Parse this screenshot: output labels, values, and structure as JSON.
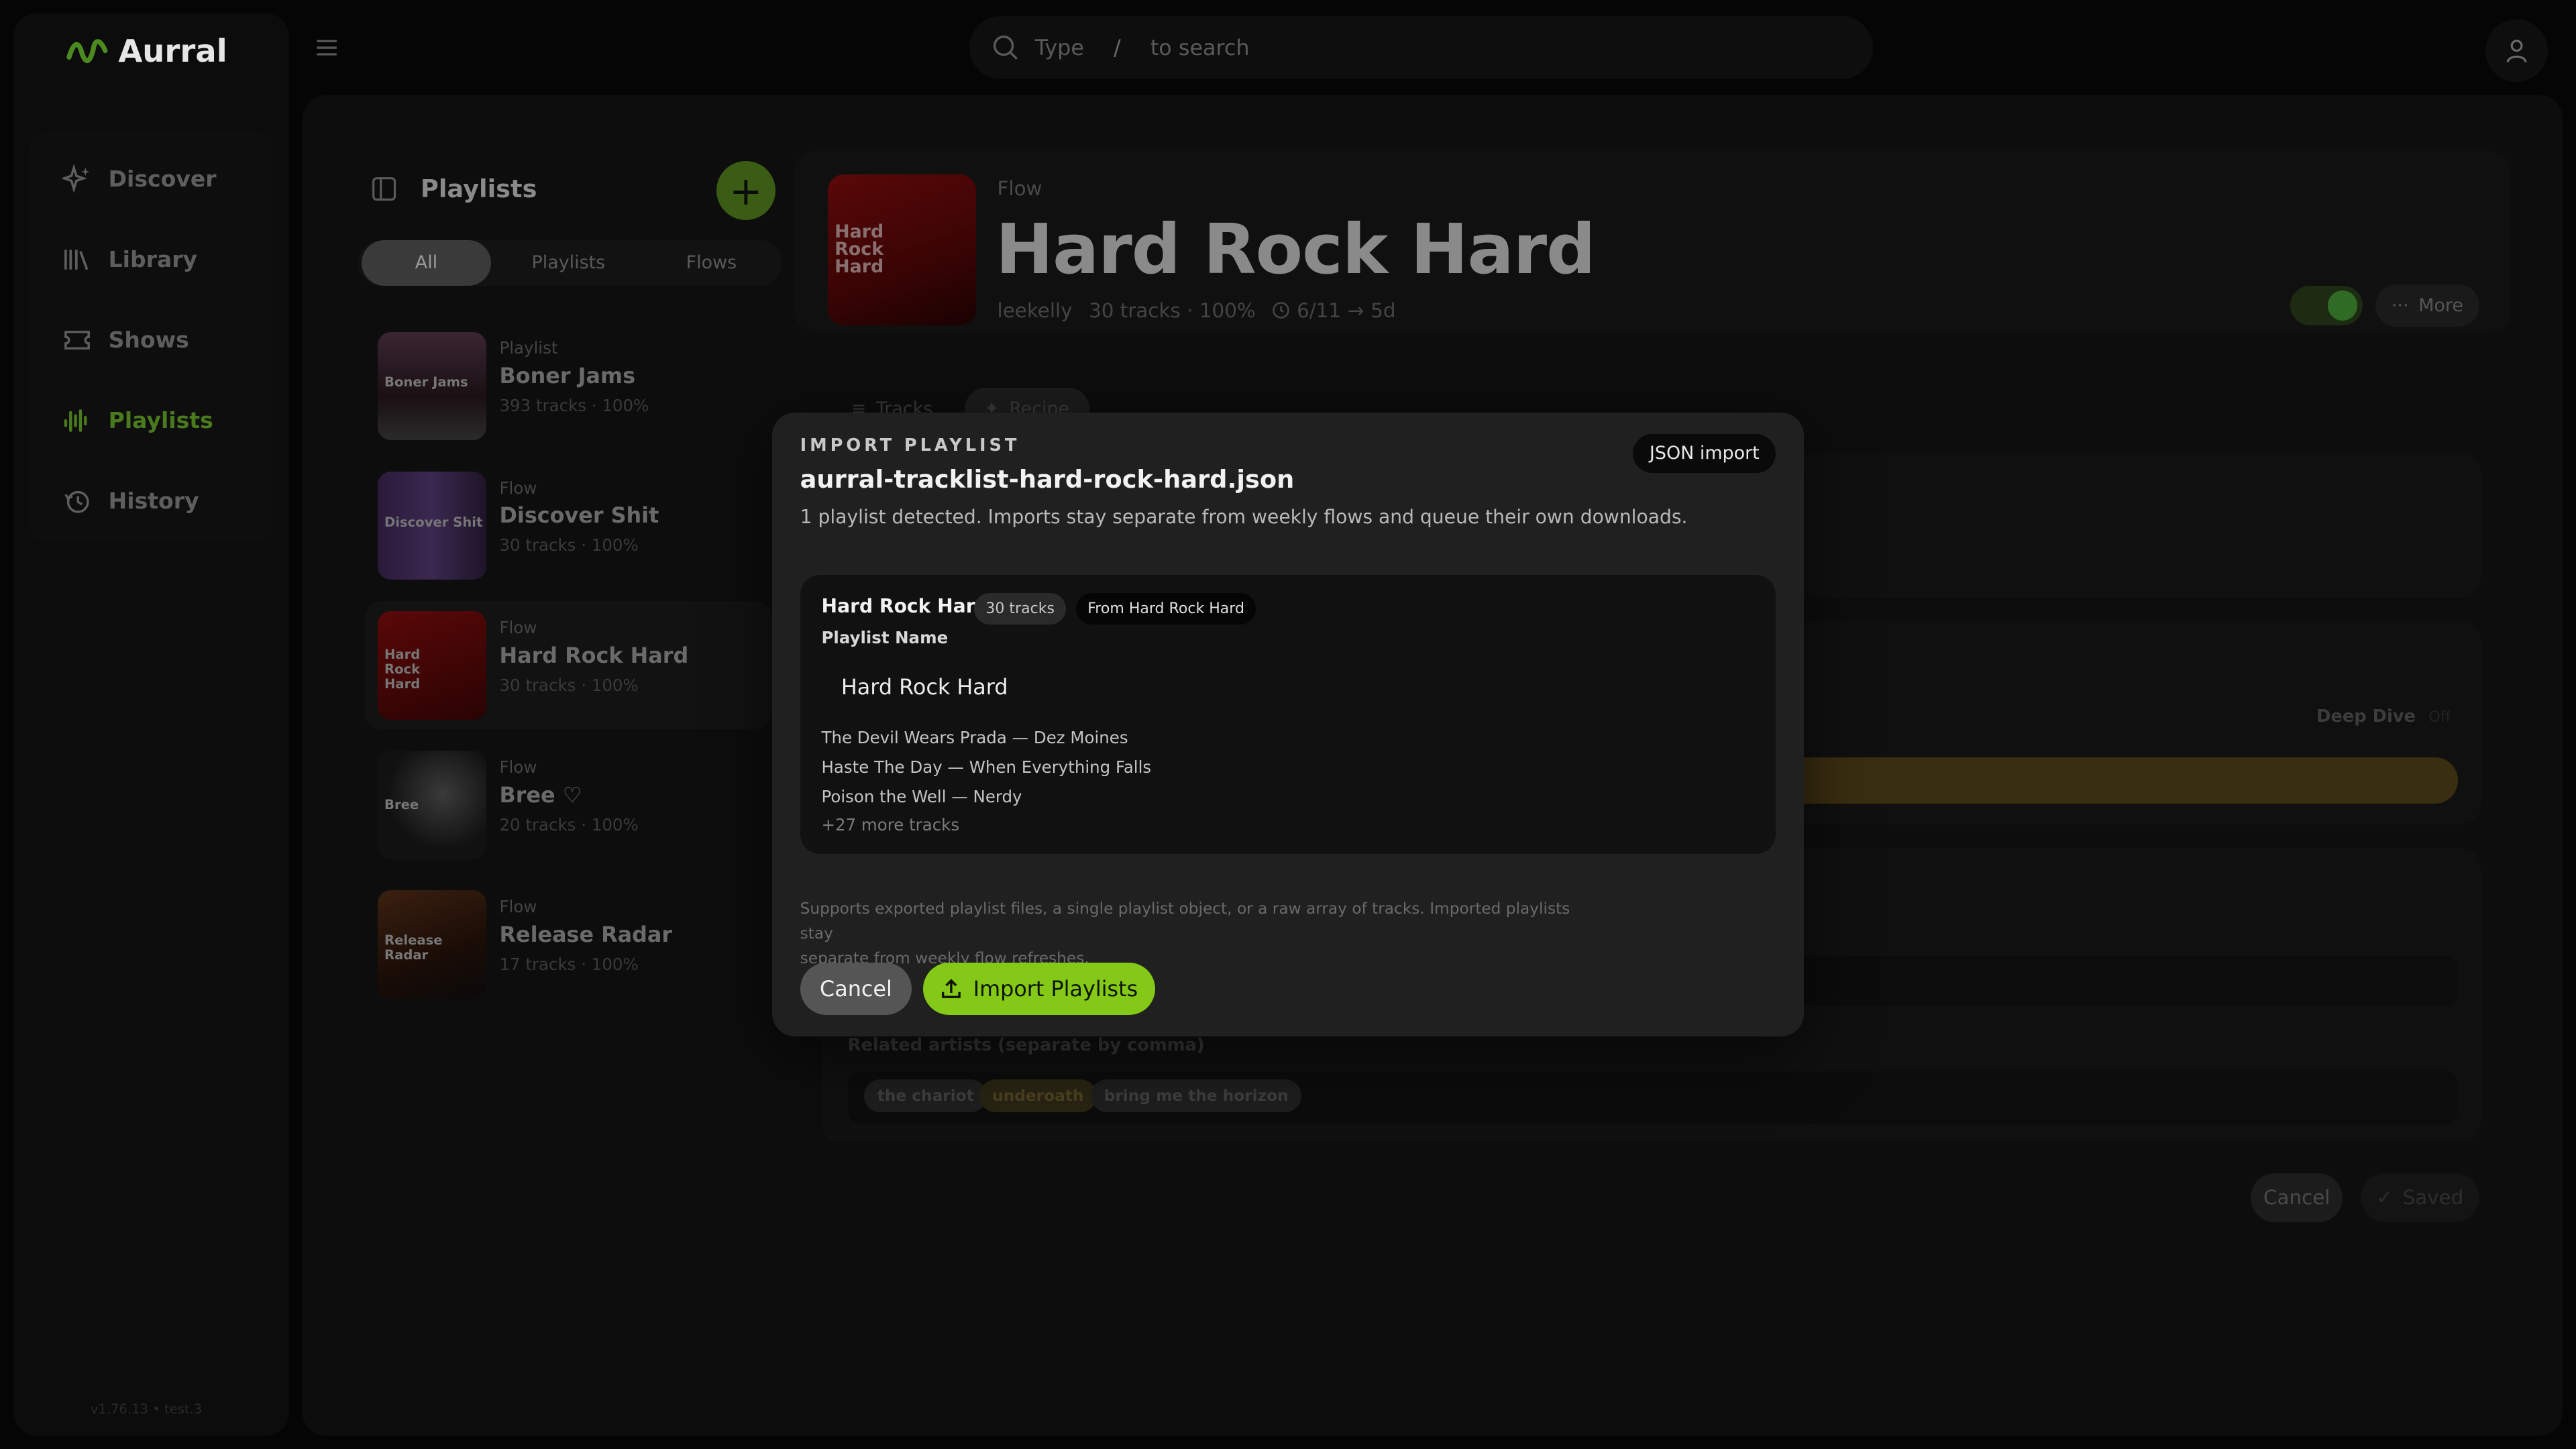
{
  "app": {
    "name": "Aurral",
    "version": "v1.76.13 • test.3"
  },
  "search": {
    "prefix": "Type",
    "key": "/",
    "suffix": "to search"
  },
  "sidebar": {
    "items": [
      {
        "label": "Discover",
        "icon": "sparkle-icon"
      },
      {
        "label": "Library",
        "icon": "library-icon"
      },
      {
        "label": "Shows",
        "icon": "ticket-icon"
      },
      {
        "label": "Playlists",
        "icon": "waveform-icon",
        "active": true
      },
      {
        "label": "History",
        "icon": "history-icon"
      }
    ]
  },
  "playlists": {
    "title": "Playlists",
    "filters": [
      "All",
      "Playlists",
      "Flows"
    ],
    "active_filter": "All",
    "items": [
      {
        "type": "Playlist",
        "name": "Boner Jams",
        "meta": "393 tracks · 100%",
        "cover_text": "Boner Jams"
      },
      {
        "type": "Flow",
        "name": "Discover Shit",
        "meta": "30 tracks · 100%",
        "cover_text": "Discover Shit"
      },
      {
        "type": "Flow",
        "name": "Hard Rock Hard",
        "meta": "30 tracks · 100%",
        "cover_text": "Hard Rock Hard",
        "selected": true
      },
      {
        "type": "Flow",
        "name": "Bree ♡",
        "meta": "20 tracks · 100%",
        "cover_text": "Bree"
      },
      {
        "type": "Flow",
        "name": "Release Radar",
        "meta": "17 tracks · 100%",
        "cover_text": "Release Radar"
      }
    ]
  },
  "detail": {
    "type": "Flow",
    "title": "Hard Rock Hard",
    "cover_text": "Hard Rock Hard",
    "owner": "leekelly",
    "tracks": "30 tracks · 100%",
    "schedule_date": "6/11",
    "schedule_next": "5d",
    "more_label": "More",
    "tabs": [
      "Tracks",
      "Recipe"
    ],
    "active_tab": "Recipe",
    "deep_dive_label": "Deep Dive",
    "deep_dive_value": "Off",
    "related_label": "Related artists (separate by comma)",
    "related_artists": [
      "the chariot",
      "underoath",
      "bring me the horizon"
    ],
    "cancel_label": "Cancel",
    "saved_label": "Saved"
  },
  "modal": {
    "eyebrow": "IMPORT PLAYLIST",
    "filename": "aurral-tracklist-hard-rock-hard.json",
    "badge": "JSON import",
    "description": "1 playlist detected. Imports stay separate from weekly flows and queue their own downloads.",
    "card": {
      "name": "Hard Rock Hard",
      "track_count": "30 tracks",
      "source": "From Hard Rock Hard",
      "field_label": "Playlist Name",
      "field_value": "Hard Rock Hard",
      "tracks": [
        "The Devil Wears Prada — Dez Moines",
        "Haste The Day — When Everything Falls",
        "Poison the Well — Nerdy"
      ],
      "more": "+27 more tracks"
    },
    "help_line1": "Supports exported playlist files, a single playlist object, or a raw array of tracks. Imported playlists stay",
    "help_line2": "separate from weekly flow refreshes.",
    "cancel_label": "Cancel",
    "import_label": "Import Playlists"
  },
  "colors": {
    "accent": "#84c818",
    "modal_bg": "#202020",
    "backdrop": "#050505"
  }
}
